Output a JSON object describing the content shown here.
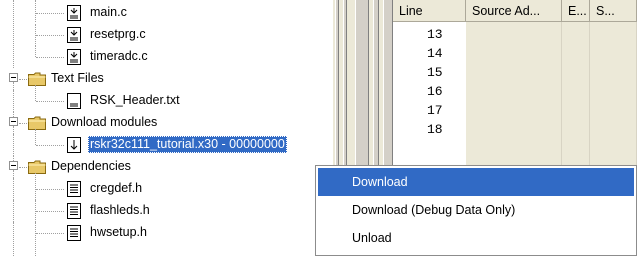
{
  "tree": {
    "items": [
      {
        "id": "main-c",
        "label": "main.c",
        "type": "file"
      },
      {
        "id": "resetprg-c",
        "label": "resetprg.c",
        "type": "file"
      },
      {
        "id": "timeradc-c",
        "label": "timeradc.c",
        "type": "file"
      },
      {
        "id": "text-files",
        "label": "Text Files",
        "type": "folder"
      },
      {
        "id": "rsk-header",
        "label": "RSK_Header.txt",
        "type": "file"
      },
      {
        "id": "download-modules",
        "label": "Download modules",
        "type": "folder"
      },
      {
        "id": "download-module",
        "label": "rskr32c111_tutorial.x30 - 00000000",
        "type": "download",
        "selected": true
      },
      {
        "id": "dependencies",
        "label": "Dependencies",
        "type": "folder"
      },
      {
        "id": "cregdef-h",
        "label": "cregdef.h",
        "type": "file"
      },
      {
        "id": "flashleds-h",
        "label": "flashleds.h",
        "type": "file"
      },
      {
        "id": "hwsetup-h",
        "label": "hwsetup.h",
        "type": "file"
      }
    ]
  },
  "list": {
    "columns": [
      "Line",
      "Source Ad...",
      "E...",
      "S..."
    ],
    "line_numbers": [
      "13",
      "14",
      "15",
      "16",
      "17",
      "18"
    ]
  },
  "context_menu": {
    "items": [
      {
        "label": "Download",
        "highlighted": true
      },
      {
        "label": "Download (Debug Data Only)",
        "highlighted": false
      },
      {
        "label": "Unload",
        "highlighted": false
      }
    ]
  },
  "colors": {
    "selection": "#316ac5",
    "folder": "#e8c868",
    "chrome": "#ece9d8"
  },
  "icons": {
    "file": "source-file-icon",
    "folder": "folder-icon",
    "download": "download-arrow-icon"
  }
}
